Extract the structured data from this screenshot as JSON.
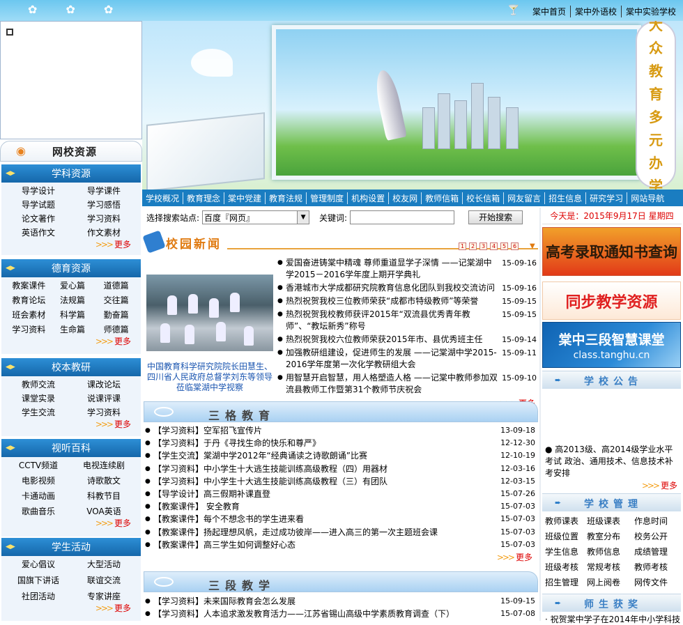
{
  "top_links": [
    "棠中首页",
    "棠中外语校",
    "棠中实验学校"
  ],
  "banner_slogan": [
    "大",
    "众",
    "教",
    "育",
    "多",
    "元",
    "办",
    "学"
  ],
  "nav": [
    "学校概况",
    "教育理念",
    "棠中党建",
    "教育法规",
    "管理制度",
    "机构设置",
    "校友网",
    "教师信箱",
    "校长信箱",
    "网友留言",
    "招生信息",
    "研究学习",
    "网站导航"
  ],
  "net_resources": "网校资源",
  "sections": [
    {
      "title": "学科资源",
      "items": [
        "导学设计",
        "导学课件",
        "导学试题",
        "学习感悟",
        "论文著作",
        "学习资料",
        "英语作文",
        "作文素材"
      ],
      "more": "更多"
    },
    {
      "title": "德育资源",
      "items": [
        "教案课件",
        "爱心篇",
        "道德篇",
        "教育论坛",
        "法规篇",
        "交往篇",
        "班会素材",
        "科学篇",
        "勤奋篇",
        "学习资料",
        "生命篇",
        "师德篇"
      ],
      "more": "更多"
    },
    {
      "title": "校本教研",
      "items": [
        "教师交流",
        "课改论坛",
        "课堂实录",
        "说课评课",
        "学生交流",
        "学习资料"
      ],
      "more": "更多"
    },
    {
      "title": "视听百科",
      "items": [
        "CCTV频道",
        "电视连续剧",
        "电影视频",
        "诗歌散文",
        "卡通动画",
        "科教节目",
        "歌曲音乐",
        "VOA英语"
      ],
      "more": "更多"
    },
    {
      "title": "学生活动",
      "items": [
        "爱心倡议",
        "大型活动",
        "国旗下讲话",
        "联谊交流",
        "社团活动",
        "专家讲座"
      ],
      "more": "更多"
    }
  ],
  "search": {
    "label": "选择搜索站点:",
    "selected": "百度『网页』",
    "kw_label": "关键词:",
    "button": "开始搜索"
  },
  "campus_news": {
    "title": "校园新闻",
    "pages": [
      "1",
      "2",
      "3",
      "4",
      "5",
      "6"
    ],
    "photo_caption": "中国教育科学研究院院长田慧生、四川省人民政府总督学刘东等领导莅临棠湖中学视察",
    "items": [
      {
        "t": "爱国奋进铸棠中精魂 尊师重道显学子深情 ——记棠湖中学2015－2016学年度上期开学典礼",
        "d": "15-09-16"
      },
      {
        "t": "香港城市大学成都研究院教育信息化团队到我校交流访问",
        "d": "15-09-16"
      },
      {
        "t": "热烈祝贺我校三位教师荣获“成都市特级教师”等荣誉",
        "d": "15-09-15"
      },
      {
        "t": "热烈祝贺我校教师获评2015年“双流县优秀青年教师”、“教坛新秀”称号",
        "d": "15-09-15"
      },
      {
        "t": "热烈祝贺我校六位教师荣获2015年市、县优秀班主任",
        "d": "15-09-14"
      },
      {
        "t": "加强教研组建设，促进师生的发展 ——记棠湖中学2015-2016学年度第一次化学教研组大会",
        "d": "15-09-11"
      },
      {
        "t": "用智慧开启智慧，用人格塑造人格 ——记棠中教师参加双流县教师工作暨第31个教师节庆祝会",
        "d": "15-09-10"
      }
    ],
    "more": "更多"
  },
  "sange": {
    "title": "三格教育",
    "items": [
      {
        "t": "【学习资料】空军招飞宣传片",
        "d": "13-09-18"
      },
      {
        "t": "【学习资料】于丹《寻找生命的快乐和尊严》",
        "d": "12-12-30"
      },
      {
        "t": "【学生交流】棠湖中学2012年“经典诵读之诗歌朗诵”比赛",
        "d": "12-10-19"
      },
      {
        "t": "【学习资料】中小学生十大逃生技能训练高级教程（四）用器材",
        "d": "12-03-16"
      },
      {
        "t": "【学习资料】中小学生十大逃生技能训练高级教程（三）有团队",
        "d": "12-03-15"
      },
      {
        "t": "【导学设计】高三假期补课直登",
        "d": "15-07-26"
      },
      {
        "t": "【教案课件】 安全教育",
        "d": "15-07-03"
      },
      {
        "t": "【教案课件】每个不想念书的学生进来看",
        "d": "15-07-03"
      },
      {
        "t": "【教案课件】扬起理想风帆，走过成功彼岸——进入高三的第一次主题班会课",
        "d": "15-07-03"
      },
      {
        "t": "【教案课件】高三学生如何调整好心态",
        "d": "15-07-03"
      }
    ],
    "more": "更多"
  },
  "sanduan": {
    "title": "三段教学",
    "items": [
      {
        "t": "【学习资料】未来国际教育会怎么发展",
        "d": "15-09-15"
      },
      {
        "t": "【学习资料】人本追求激发教育活力——江苏省锡山高级中学素质教育调查（下）",
        "d": "15-07-08"
      }
    ]
  },
  "right": {
    "today": "今天是：2015年9月17日 星期四",
    "ad1": "高考录取通知书查询",
    "ad2": "同步教学资源",
    "ad3_title": "棠中三段智慧课堂",
    "ad3_url": "class.tanghu.cn",
    "notice_title": "学校公告",
    "notice_text": "高2013级、高2014级学业水平考试 政治、通用技术、信息技术补考安排",
    "notice_more": "更多",
    "mgmt_title": "学校管理",
    "mgmt_items": [
      "教师课表",
      "班级课表",
      "作息时间",
      "班级位置",
      "教室分布",
      "校务公开",
      "学生信息",
      "教师信息",
      "成绩管理",
      "班级考核",
      "常规考核",
      "教师考核",
      "招生管理",
      "网上阅卷",
      "网传文件"
    ],
    "award_title": "师生获奖",
    "award_text": "· 祝贺棠中学子在2014年中小学科技"
  }
}
